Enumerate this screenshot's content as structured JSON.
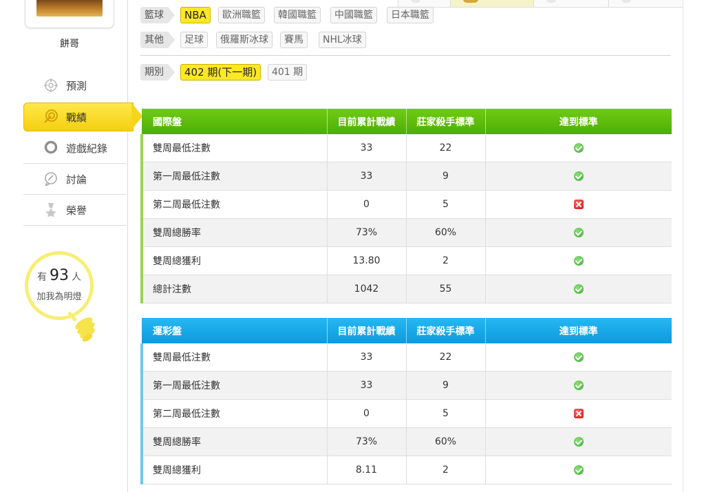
{
  "user": {
    "name": "餅哥"
  },
  "nav": {
    "items": [
      {
        "label": "預測",
        "icon": "target-icon"
      },
      {
        "label": "戰績",
        "icon": "bullseye-icon"
      },
      {
        "label": "遊戲紀錄",
        "icon": "ring-icon"
      },
      {
        "label": "討論",
        "icon": "chat-bubble-icon"
      },
      {
        "label": "榮譽",
        "icon": "medal-icon"
      }
    ]
  },
  "fans": {
    "prefix": "有",
    "count": "93",
    "suffix": "人",
    "line2": "加我為明燈"
  },
  "filters": {
    "basketball": {
      "label": "籃球",
      "chips": [
        "NBA",
        "歐洲職籃",
        "韓國職籃",
        "中國職籃",
        "日本職籃"
      ],
      "selected": "NBA"
    },
    "other": {
      "label": "其他",
      "chips": [
        "足球",
        "俄羅斯冰球",
        "賽馬",
        "NHL冰球"
      ]
    },
    "period": {
      "label": "期別",
      "chips": [
        "402 期(下一期)",
        "401 期"
      ],
      "selected": "402 期(下一期)"
    }
  },
  "intl_table": {
    "headers": [
      "國際盤",
      "目前累計戰績",
      "莊家殺手標準",
      "達到標準"
    ],
    "rows": [
      {
        "name": "雙周最低注數",
        "current": "33",
        "standard": "22",
        "status": "ok"
      },
      {
        "name": "第一周最低注數",
        "current": "33",
        "standard": "9",
        "status": "ok"
      },
      {
        "name": "第二周最低注數",
        "current": "0",
        "standard": "5",
        "status": "fail"
      },
      {
        "name": "雙周總勝率",
        "current": "73%",
        "standard": "60%",
        "status": "ok"
      },
      {
        "name": "雙周總獲利",
        "current": "13.80",
        "standard": "2",
        "status": "ok"
      },
      {
        "name": "總計注數",
        "current": "1042",
        "standard": "55",
        "status": "ok"
      }
    ]
  },
  "lottery_table": {
    "headers": [
      "運彩盤",
      "目前累計戰績",
      "莊家殺手標準",
      "達到標準"
    ],
    "rows": [
      {
        "name": "雙周最低注數",
        "current": "33",
        "standard": "22",
        "status": "ok"
      },
      {
        "name": "第一周最低注數",
        "current": "33",
        "standard": "9",
        "status": "ok"
      },
      {
        "name": "第二周最低注數",
        "current": "0",
        "standard": "5",
        "status": "fail"
      },
      {
        "name": "雙周總勝率",
        "current": "73%",
        "standard": "60%",
        "status": "ok"
      },
      {
        "name": "雙周總獲利",
        "current": "8.11",
        "standard": "2",
        "status": "ok"
      }
    ]
  },
  "colors": {
    "intl_header": "#5bbb0b",
    "lottery_header": "#13a6e8",
    "selected_chip": "#fde825"
  }
}
